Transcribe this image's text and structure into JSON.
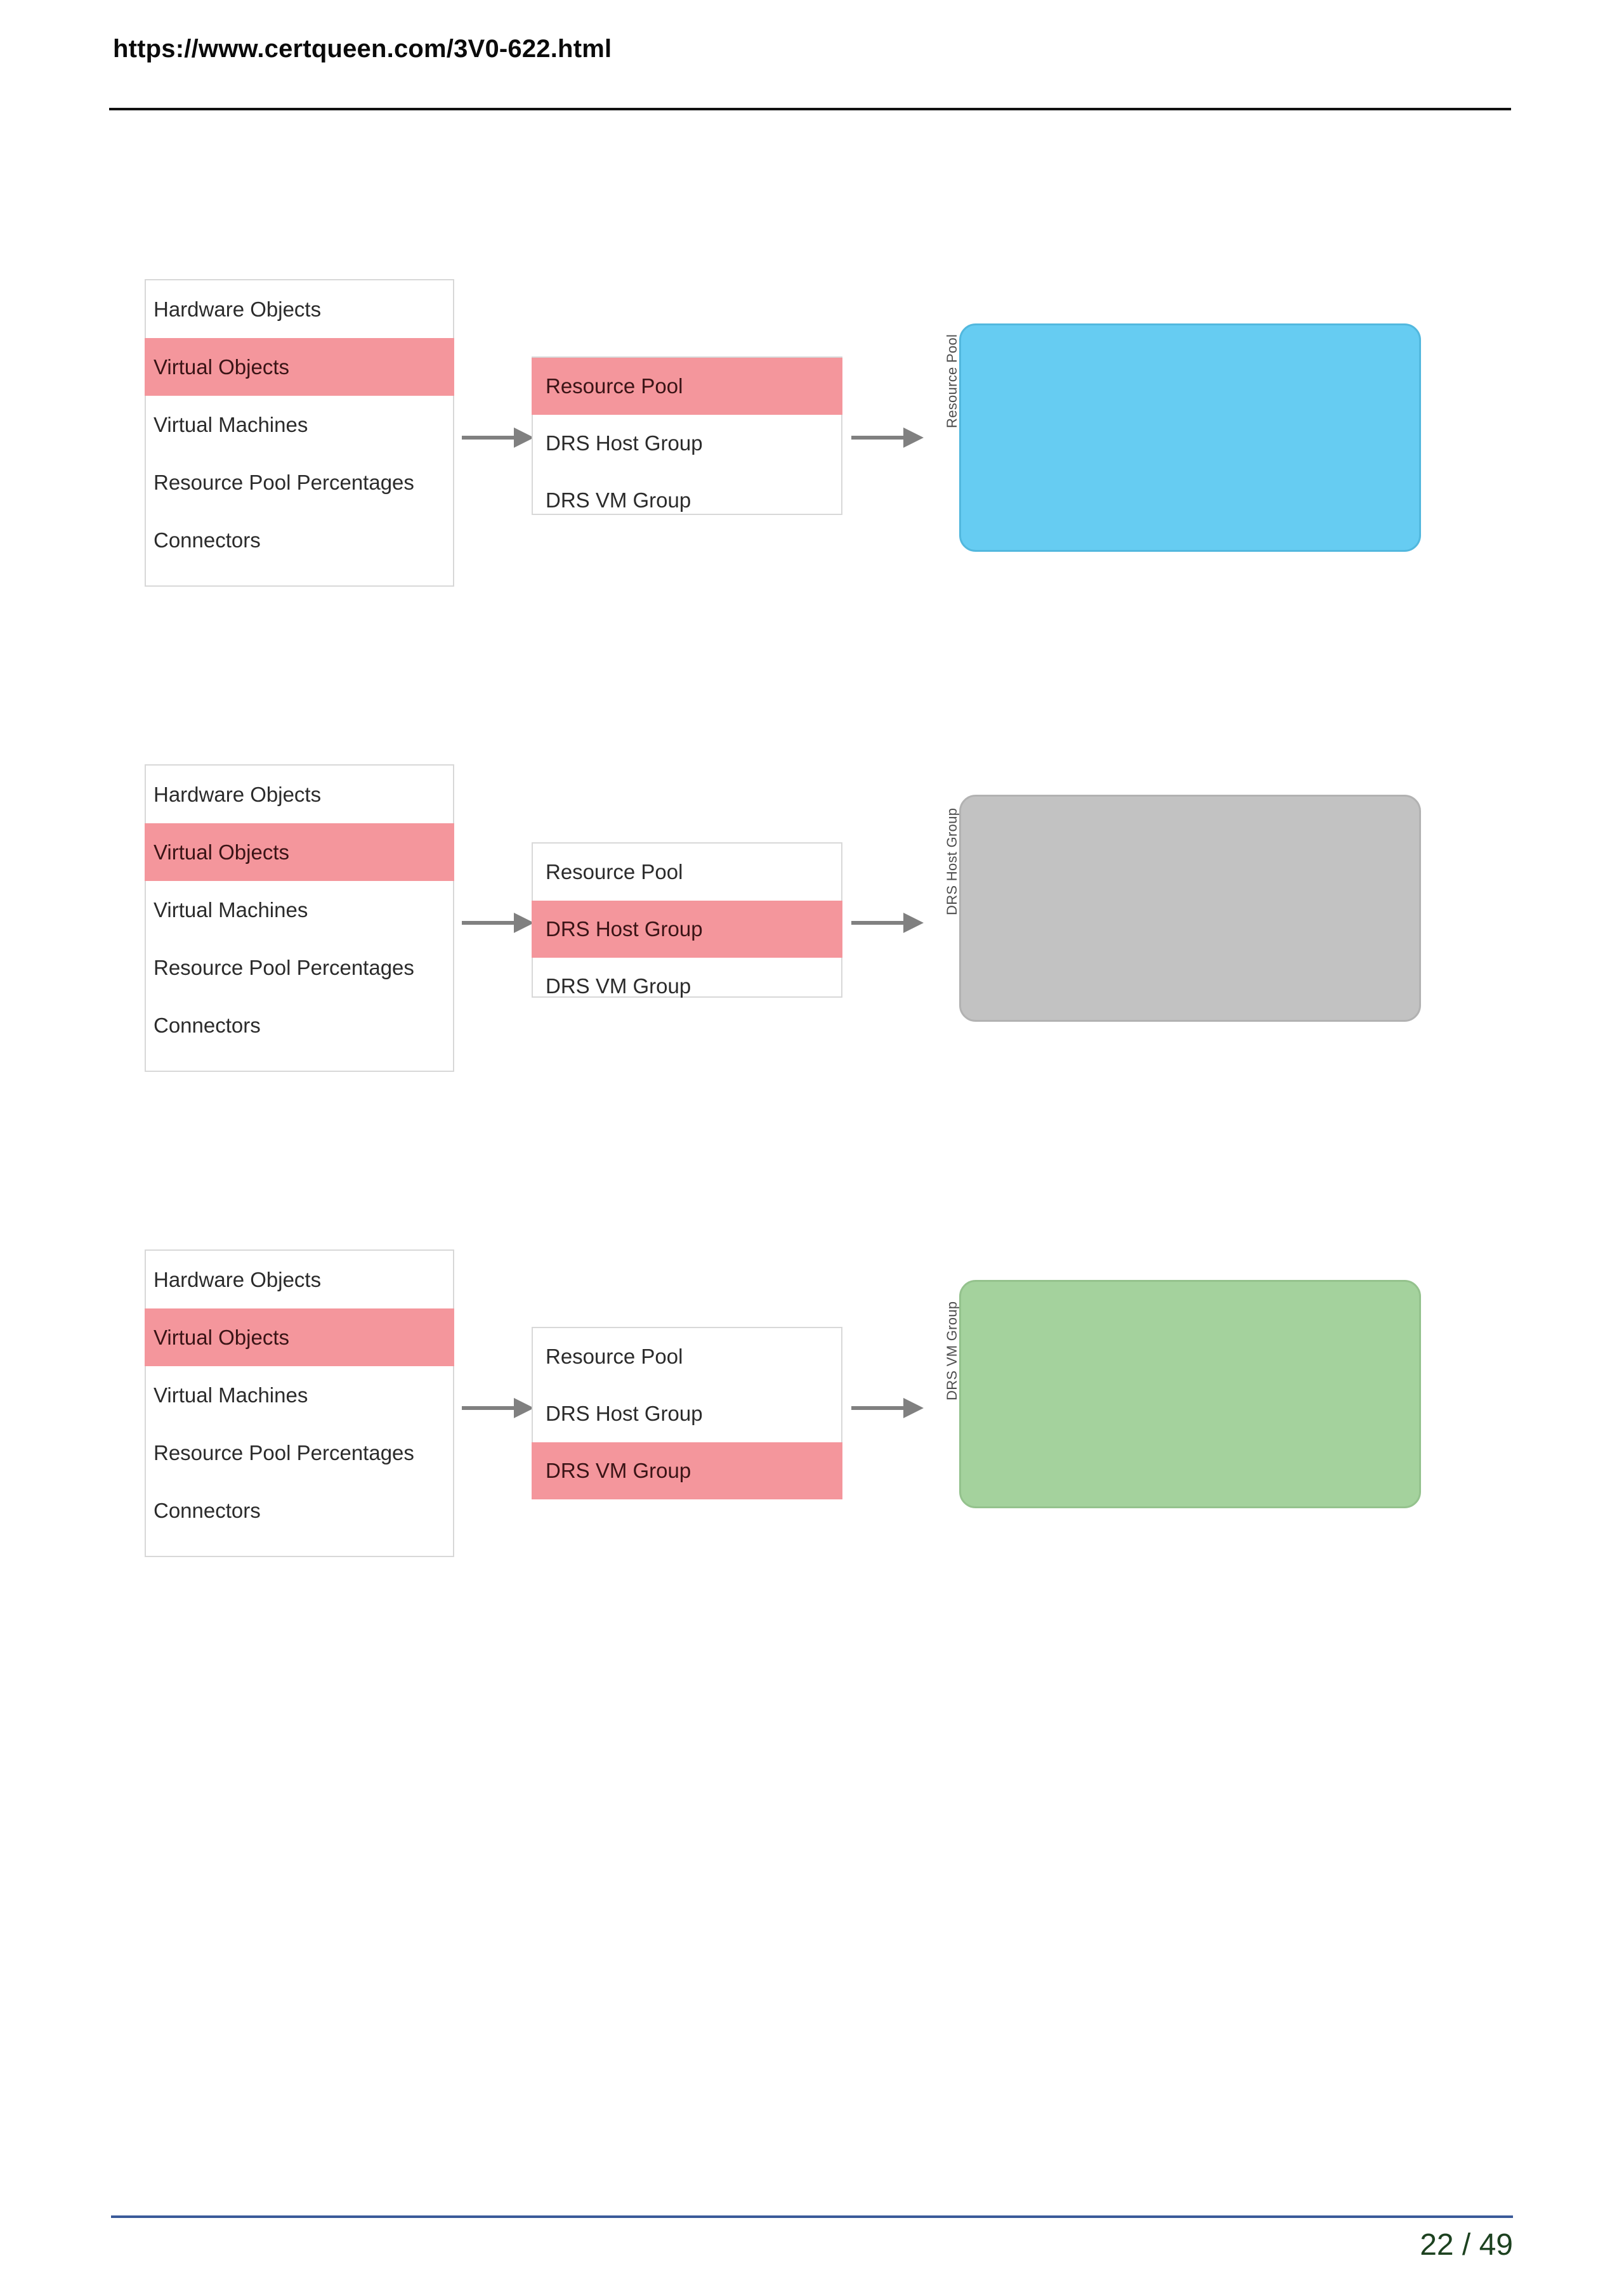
{
  "header": {
    "url": "https://www.certqueen.com/3V0-622.html"
  },
  "footer": {
    "page_number": "22 / 49"
  },
  "palette": {
    "highlight_pink": "#F4969C",
    "target_blue": "#66CCF2",
    "target_gray": "#C2C2C2",
    "target_green": "#A4D29D",
    "panel_border": "#D8D8D8",
    "arrow_gray": "#808080",
    "footer_rule_blue": "#3A5A99",
    "footer_text_green": "#1D4220",
    "header_rule_black": "#111111"
  },
  "diagram": {
    "source_panel_items": [
      "Hardware Objects",
      "Virtual Objects",
      "Virtual Machines",
      "Resource Pool Percentages",
      "Connectors"
    ],
    "option_panel_items": [
      "Resource Pool",
      "DRS Host Group",
      "DRS VM Group"
    ],
    "groups": [
      {
        "id": "group-resource-pool",
        "source_selected": "Virtual Objects",
        "source_selected_index": 1,
        "option_selected": "Resource Pool",
        "option_selected_index": 0,
        "target_label": "Resource Pool",
        "target_color": "#66CCF2",
        "arrow_1": "arrow-right",
        "arrow_2": "arrow-right"
      },
      {
        "id": "group-drs-host-group",
        "source_selected": "Virtual Objects",
        "source_selected_index": 1,
        "option_selected": "DRS Host Group",
        "option_selected_index": 1,
        "target_label": "DRS Host Group",
        "target_color": "#C2C2C2",
        "arrow_1": "arrow-right",
        "arrow_2": "arrow-right"
      },
      {
        "id": "group-drs-vm-group",
        "source_selected": "Virtual Objects",
        "source_selected_index": 1,
        "option_selected": "DRS VM Group",
        "option_selected_index": 2,
        "target_label": "DRS VM Group",
        "target_color": "#A4D29D",
        "arrow_1": "arrow-right",
        "arrow_2": "arrow-right"
      }
    ]
  }
}
